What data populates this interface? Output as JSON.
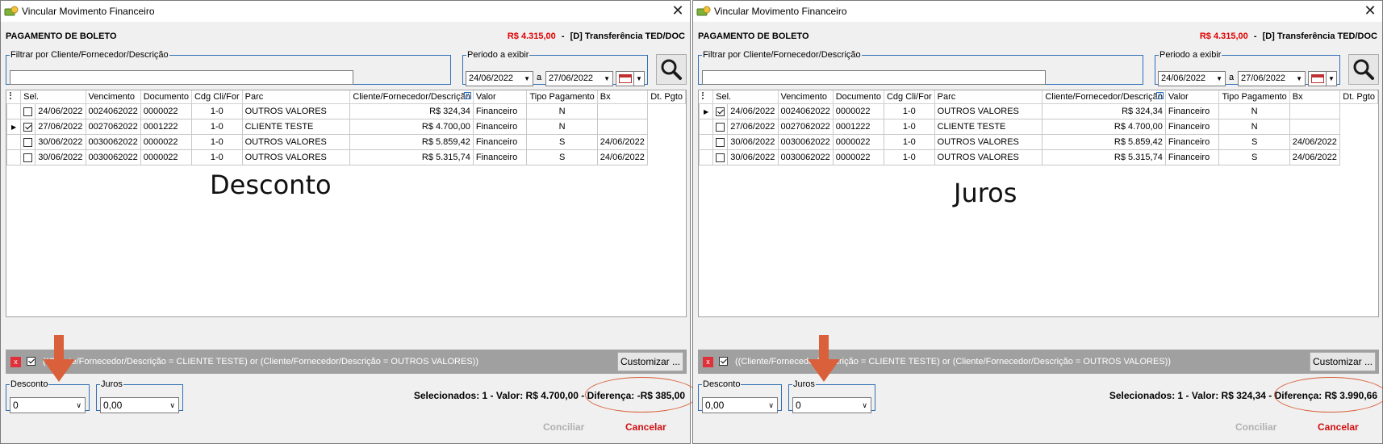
{
  "windows": [
    {
      "title": "Vincular Movimento Financeiro",
      "header_label": "PAGAMENTO DE BOLETO",
      "header_amount": "R$ 4.315,00",
      "header_sep": "-",
      "header_account": "[D] Transferência TED/DOC",
      "filter_legend": "Filtrar por Cliente/Fornecedor/Descrição",
      "filter_value": "",
      "period_legend": "Periodo a exibir",
      "date_from": "24/06/2022",
      "date_sep": "a",
      "date_to": "27/06/2022",
      "columns": [
        "Sel.",
        "Vencimento",
        "Documento",
        "Cdg Cli/For",
        "Parc",
        "Cliente/Fornecedor/Descrição",
        "Valor",
        "Tipo Pagamento",
        "Bx",
        "Dt. Pgto"
      ],
      "rows": [
        {
          "current": false,
          "checked": false,
          "vencimento": "24/06/2022",
          "documento": "0024062022",
          "cdg": "0000022",
          "parc": "1-0",
          "cliente": "OUTROS VALORES",
          "valor": "R$ 324,34",
          "tipo": "Financeiro",
          "bx": "N",
          "dtpgto": ""
        },
        {
          "current": true,
          "checked": true,
          "vencimento": "27/06/2022",
          "documento": "0027062022",
          "cdg": "0001222",
          "parc": "1-0",
          "cliente": "CLIENTE TESTE",
          "valor": "R$ 4.700,00",
          "tipo": "Financeiro",
          "bx": "N",
          "dtpgto": ""
        },
        {
          "current": false,
          "checked": false,
          "vencimento": "30/06/2022",
          "documento": "0030062022",
          "cdg": "0000022",
          "parc": "1-0",
          "cliente": "OUTROS VALORES",
          "valor": "R$ 5.859,42",
          "tipo": "Financeiro",
          "bx": "S",
          "dtpgto": "24/06/2022"
        },
        {
          "current": false,
          "checked": false,
          "vencimento": "30/06/2022",
          "documento": "0030062022",
          "cdg": "0000022",
          "parc": "1-0",
          "cliente": "OUTROS VALORES",
          "valor": "R$ 5.315,74",
          "tipo": "Financeiro",
          "bx": "S",
          "dtpgto": "24/06/2022"
        }
      ],
      "annotation": "Desconto",
      "filter_expression": "((Cliente/Fornecedor/Descrição = CLIENTE TESTE) or (Cliente/Fornecedor/Descrição = OUTROS VALORES))",
      "customize_label": "Customizar ...",
      "desconto_legend": "Desconto",
      "desconto_value": "0",
      "juros_legend": "Juros",
      "juros_value": "0,00",
      "summary": "Selecionados: 1  -  Valor: R$ 4.700,00  -  Diferença: -R$ 385,00",
      "conciliar_label": "Conciliar",
      "cancelar_label": "Cancelar"
    },
    {
      "title": "Vincular Movimento Financeiro",
      "header_label": "PAGAMENTO DE BOLETO",
      "header_amount": "R$ 4.315,00",
      "header_sep": "-",
      "header_account": "[D] Transferência TED/DOC",
      "filter_legend": "Filtrar por Cliente/Fornecedor/Descrição",
      "filter_value": "",
      "period_legend": "Periodo a exibir",
      "date_from": "24/06/2022",
      "date_sep": "a",
      "date_to": "27/06/2022",
      "columns": [
        "Sel.",
        "Vencimento",
        "Documento",
        "Cdg Cli/For",
        "Parc",
        "Cliente/Fornecedor/Descrição",
        "Valor",
        "Tipo Pagamento",
        "Bx",
        "Dt. Pgto"
      ],
      "rows": [
        {
          "current": true,
          "checked": true,
          "vencimento": "24/06/2022",
          "documento": "0024062022",
          "cdg": "0000022",
          "parc": "1-0",
          "cliente": "OUTROS VALORES",
          "valor": "R$ 324,34",
          "tipo": "Financeiro",
          "bx": "N",
          "dtpgto": ""
        },
        {
          "current": false,
          "checked": false,
          "vencimento": "27/06/2022",
          "documento": "0027062022",
          "cdg": "0001222",
          "parc": "1-0",
          "cliente": "CLIENTE TESTE",
          "valor": "R$ 4.700,00",
          "tipo": "Financeiro",
          "bx": "N",
          "dtpgto": ""
        },
        {
          "current": false,
          "checked": false,
          "vencimento": "30/06/2022",
          "documento": "0030062022",
          "cdg": "0000022",
          "parc": "1-0",
          "cliente": "OUTROS VALORES",
          "valor": "R$ 5.859,42",
          "tipo": "Financeiro",
          "bx": "S",
          "dtpgto": "24/06/2022"
        },
        {
          "current": false,
          "checked": false,
          "vencimento": "30/06/2022",
          "documento": "0030062022",
          "cdg": "0000022",
          "parc": "1-0",
          "cliente": "OUTROS VALORES",
          "valor": "R$ 5.315,74",
          "tipo": "Financeiro",
          "bx": "S",
          "dtpgto": "24/06/2022"
        }
      ],
      "annotation": "Juros",
      "filter_expression": "((Cliente/Fornecedor/Descrição = CLIENTE TESTE) or (Cliente/Fornecedor/Descrição = OUTROS VALORES))",
      "customize_label": "Customizar ...",
      "desconto_legend": "Desconto",
      "desconto_value": "0,00",
      "juros_legend": "Juros",
      "juros_value": "0",
      "summary": "Selecionados: 1  -  Valor: R$ 324,34  -  Diferença: R$ 3.990,66",
      "conciliar_label": "Conciliar",
      "cancelar_label": "Cancelar"
    }
  ],
  "icons": {
    "app": "money-icon",
    "close": "close-icon",
    "search": "search-icon",
    "calendar": "calendar-icon",
    "clear_filter": "clear-filter-icon"
  },
  "colors": {
    "amount": "#e00000",
    "cancel": "#d01010",
    "group_border": "#2f6fb5",
    "annotation": "#d9603a",
    "filter_bar": "#a0a0a0"
  }
}
